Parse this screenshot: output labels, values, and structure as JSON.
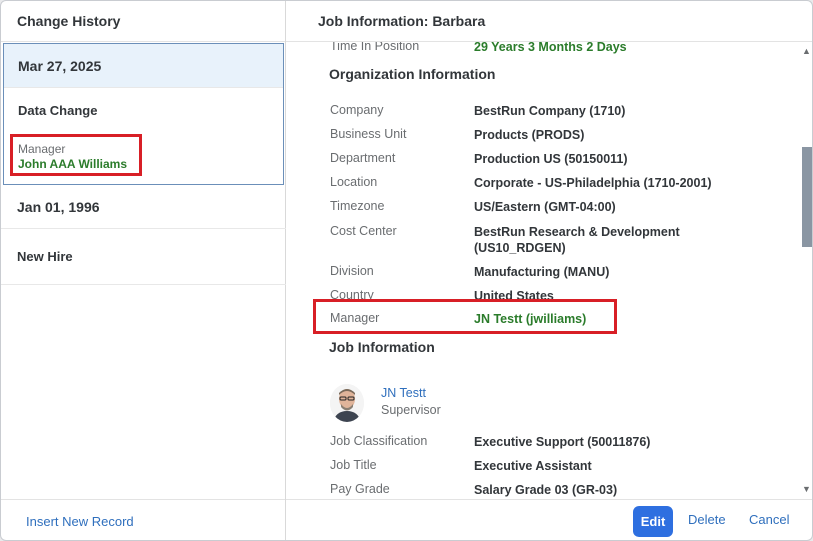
{
  "left_panel": {
    "title": "Change History",
    "records": [
      {
        "date": "Mar 27, 2025",
        "type": "Data Change",
        "change_label": "Manager",
        "change_value": "John AAA Williams"
      },
      {
        "date": "Jan 01, 1996",
        "type": "New Hire"
      }
    ],
    "insert_label": "Insert New Record"
  },
  "right_panel": {
    "title": "Job Information: Barbara",
    "time_in_position": {
      "label": "Time In Position",
      "value": "29 Years 3 Months 2 Days"
    },
    "org_section_title": "Organization Information",
    "org_fields": [
      {
        "label": "Company",
        "value": "BestRun Company (1710)"
      },
      {
        "label": "Business Unit",
        "value": "Products (PRODS)"
      },
      {
        "label": "Department",
        "value": "Production US (50150011)"
      },
      {
        "label": "Location",
        "value": "Corporate - US-Philadelphia (1710-2001)"
      },
      {
        "label": "Timezone",
        "value": "US/Eastern (GMT-04:00)"
      },
      {
        "label": "Cost Center",
        "value": "BestRun Research & Development (US10_RDGEN)"
      },
      {
        "label": "Division",
        "value": "Manufacturing (MANU)"
      },
      {
        "label": "Country",
        "value": "United States"
      },
      {
        "label": "Manager",
        "value": "JN Testt (jwilliams)"
      }
    ],
    "job_section_title": "Job Information",
    "supervisor": {
      "name": "JN Testt",
      "role": "Supervisor"
    },
    "job_fields": [
      {
        "label": "Job Classification",
        "value": "Executive Support (50011876)"
      },
      {
        "label": "Job Title",
        "value": "Executive Assistant"
      },
      {
        "label": "Pay Grade",
        "value": "Salary Grade 03 (GR-03)"
      }
    ],
    "buttons": {
      "edit": "Edit",
      "delete": "Delete",
      "cancel": "Cancel"
    }
  },
  "colors": {
    "accent": "#2e6fe0",
    "highlight_box": "#d81f26",
    "changed_value": "#2b7c2b",
    "selected_bg": "#e8f2fb"
  },
  "icons": {
    "scroll_up": "▲",
    "scroll_down": "▼"
  }
}
